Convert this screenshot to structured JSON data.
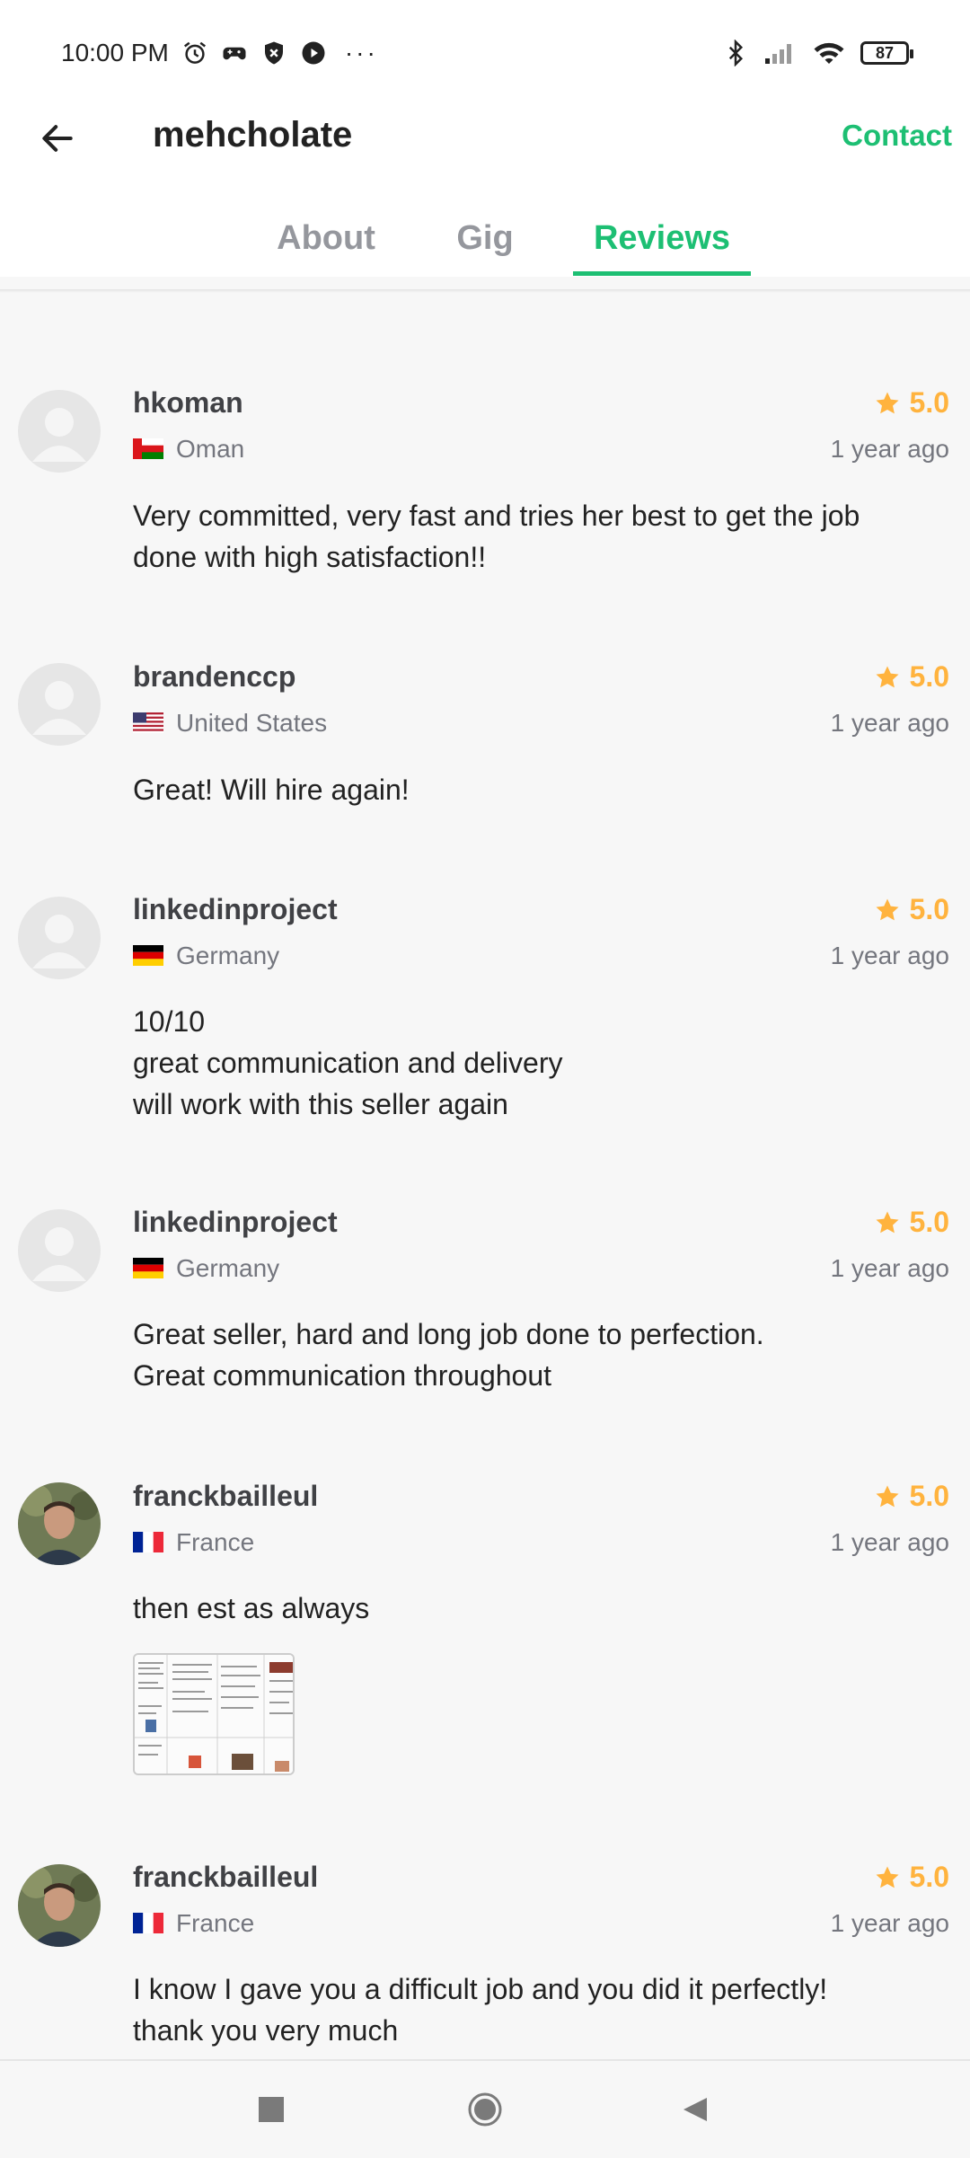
{
  "status_bar": {
    "time": "10:00 PM",
    "battery": "87",
    "icons": [
      "alarm-icon",
      "game-controller-icon",
      "shield-icon",
      "media-icon",
      "more-icon",
      "bluetooth-icon",
      "signal-icon",
      "wifi-icon"
    ]
  },
  "header": {
    "title": "mehcholate",
    "contact_label": "Contact",
    "back_icon": "arrow-left-icon"
  },
  "tabs": [
    {
      "label": "About",
      "active": false
    },
    {
      "label": "Gig",
      "active": false
    },
    {
      "label": "Reviews",
      "active": true
    }
  ],
  "colors": {
    "accent": "#1dbf73",
    "rating": "#ffb33e",
    "muted_text": "#74767e",
    "background": "#f7f7f7"
  },
  "reviews": [
    {
      "name": "hkoman",
      "rating": "5.0",
      "country": "Oman",
      "flag": "flag-oman",
      "time": "1 year ago",
      "text": "Very committed, very fast and tries her best to get the job\ndone with high satisfaction!!",
      "avatar": "default-avatar"
    },
    {
      "name": "brandenccp",
      "rating": "5.0",
      "country": "United States",
      "flag": "flag-united-states",
      "time": "1 year ago",
      "text": "Great! Will hire again!",
      "avatar": "default-avatar"
    },
    {
      "name": "linkedinproject",
      "rating": "5.0",
      "country": "Germany",
      "flag": "flag-germany",
      "time": "1 year ago",
      "text": "10/10\ngreat communication and delivery\nwill work with this seller again",
      "avatar": "default-avatar"
    },
    {
      "name": "linkedinproject",
      "rating": "5.0",
      "country": "Germany",
      "flag": "flag-germany",
      "time": "1 year ago",
      "text": "Great seller, hard and long job done to perfection.\nGreat communication throughout",
      "avatar": "default-avatar"
    },
    {
      "name": "franckbailleul",
      "rating": "5.0",
      "country": "France",
      "flag": "flag-france",
      "time": "1 year ago",
      "text": "then est as always",
      "avatar": "photo-avatar",
      "attachment": "document-thumbnail"
    },
    {
      "name": "franckbailleul",
      "rating": "5.0",
      "country": "France",
      "flag": "flag-france",
      "time": "1 year ago",
      "text": "I know I gave you a difficult job and you did it perfectly!\nthank you very much",
      "avatar": "photo-avatar"
    }
  ],
  "nav_bar": {
    "buttons": [
      "recents-square-icon",
      "home-circle-icon",
      "back-triangle-icon"
    ]
  }
}
